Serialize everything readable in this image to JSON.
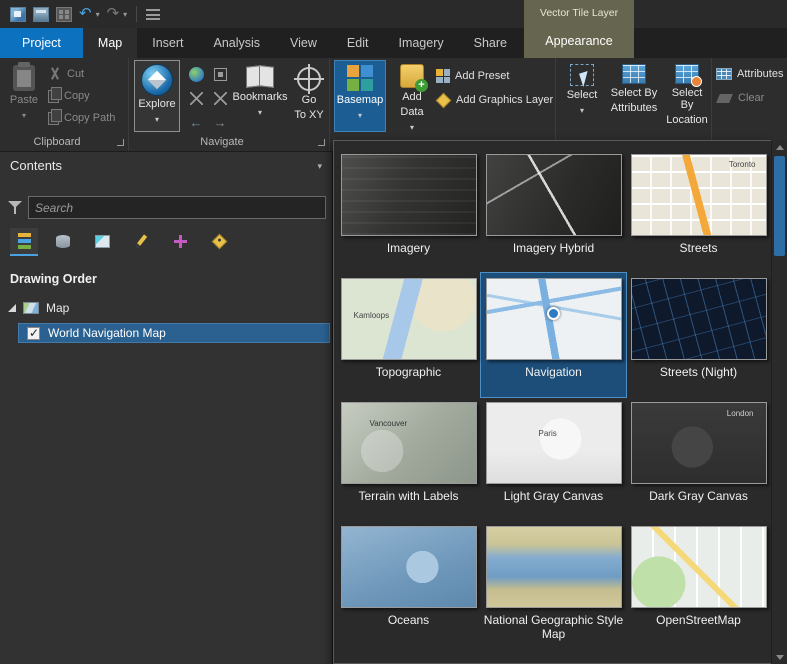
{
  "accent": {
    "blue": "#0c72c0",
    "selection_blue": "#2b6190",
    "contextual_olive": "#66654f"
  },
  "tabs": [
    {
      "label": "Project"
    },
    {
      "label": "Map"
    },
    {
      "label": "Insert"
    },
    {
      "label": "Analysis"
    },
    {
      "label": "View"
    },
    {
      "label": "Edit"
    },
    {
      "label": "Imagery"
    },
    {
      "label": "Share"
    },
    {
      "label": "Appearance"
    }
  ],
  "contextual_group": {
    "label": "Vector Tile Layer"
  },
  "ribbon": {
    "clipboard": {
      "group_label": "Clipboard",
      "paste": "Paste",
      "cut": "Cut",
      "copy": "Copy",
      "copy_path": "Copy Path"
    },
    "navigate": {
      "group_label": "Navigate",
      "explore": "Explore",
      "bookmarks": "Bookmarks",
      "goto_line1": "Go",
      "goto_line2": "To XY"
    },
    "layer": {
      "basemap": "Basemap",
      "add_line1": "Add",
      "add_line2": "Data",
      "add_preset": "Add Preset",
      "add_graphics_layer": "Add Graphics Layer"
    },
    "selection": {
      "select": "Select",
      "select_by_attributes_line1": "Select By",
      "select_by_attributes_line2": "Attributes",
      "select_by_location_line1": "Select By",
      "select_by_location_line2": "Location"
    },
    "attributes_group": {
      "attributes": "Attributes",
      "clear": "Clear"
    }
  },
  "contents": {
    "title": "Contents",
    "search_placeholder": "Search",
    "drawing_order": "Drawing Order",
    "map_item": "Map",
    "layer_item": "World Navigation Map"
  },
  "basemap_gallery": {
    "items": [
      {
        "label": "Imagery",
        "annotation": ""
      },
      {
        "label": "Imagery Hybrid",
        "annotation": ""
      },
      {
        "label": "Streets",
        "annotation": "Toronto"
      },
      {
        "label": "Topographic",
        "annotation": "Kamloops"
      },
      {
        "label": "Navigation",
        "annotation": "",
        "selected": true
      },
      {
        "label": "Streets (Night)",
        "annotation": ""
      },
      {
        "label": "Terrain with Labels",
        "annotation": "Vancouver"
      },
      {
        "label": "Light Gray Canvas",
        "annotation": "Paris"
      },
      {
        "label": "Dark Gray Canvas",
        "annotation": "London"
      },
      {
        "label": "Oceans",
        "annotation": ""
      },
      {
        "label": "National Geographic Style Map",
        "annotation": ""
      },
      {
        "label": "OpenStreetMap",
        "annotation": ""
      }
    ]
  }
}
